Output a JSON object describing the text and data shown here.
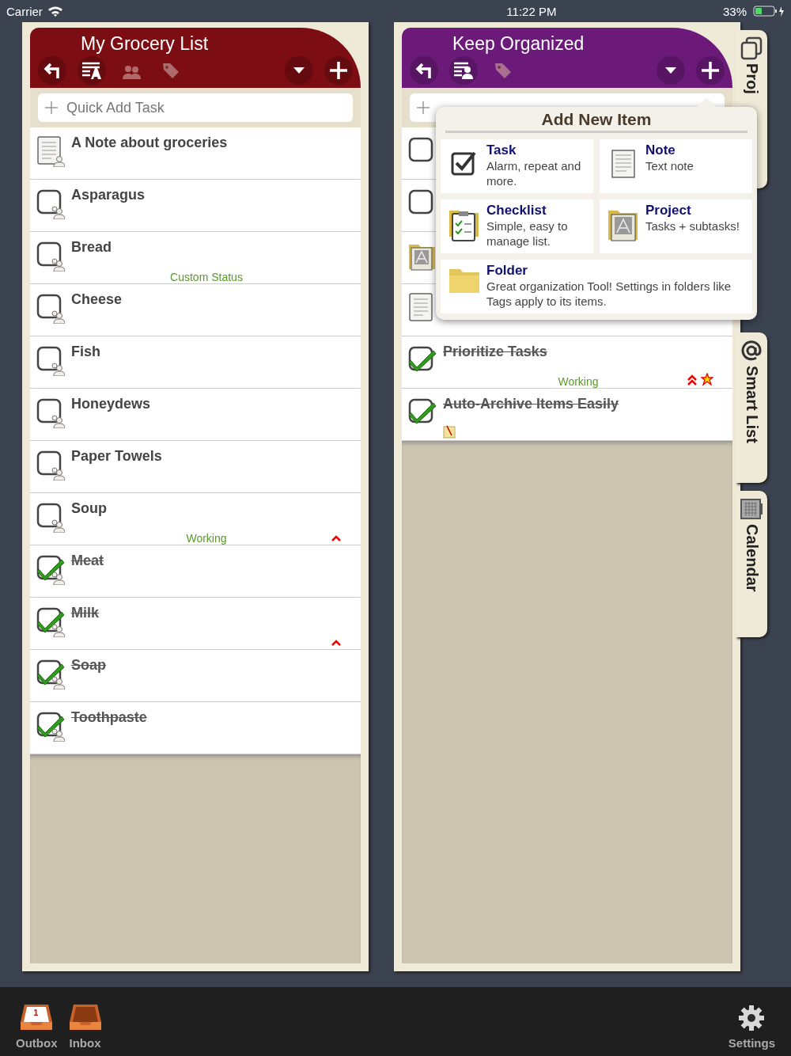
{
  "status_bar": {
    "carrier": "Carrier",
    "time": "11:22 PM",
    "battery": "33%"
  },
  "lists": [
    {
      "title": "My Grocery List",
      "color": "#7c0d12",
      "toolbar": [
        {
          "kind": "back",
          "disabled": false
        },
        {
          "kind": "format",
          "disabled": false
        },
        {
          "kind": "people",
          "disabled": true
        },
        {
          "kind": "tag",
          "disabled": true
        },
        {
          "kind": "dropdown",
          "disabled": false
        },
        {
          "kind": "add",
          "disabled": false
        }
      ],
      "quick_add": {
        "placeholder": "Quick Add Task"
      },
      "items": [
        {
          "kind": "note",
          "title": "A Note about groceries",
          "shared": true
        },
        {
          "kind": "task",
          "title": "Asparagus",
          "done": false,
          "shared": true
        },
        {
          "kind": "task",
          "title": "Bread",
          "done": false,
          "shared": true,
          "status": "Custom Status"
        },
        {
          "kind": "task",
          "title": "Cheese",
          "done": false,
          "shared": true
        },
        {
          "kind": "task",
          "title": "Fish",
          "done": false,
          "shared": true
        },
        {
          "kind": "task",
          "title": "Honeydews",
          "done": false,
          "shared": true
        },
        {
          "kind": "task",
          "title": "Paper Towels",
          "done": false,
          "shared": true
        },
        {
          "kind": "task",
          "title": "Soup",
          "done": false,
          "shared": true,
          "status": "Working",
          "priority": true
        },
        {
          "kind": "task",
          "title": "Meat",
          "done": true,
          "shared": true
        },
        {
          "kind": "task",
          "title": "Milk",
          "done": true,
          "shared": true,
          "priority": true
        },
        {
          "kind": "task",
          "title": "Soap",
          "done": true,
          "shared": true
        },
        {
          "kind": "task",
          "title": "Toothpaste",
          "done": true,
          "shared": true
        }
      ]
    },
    {
      "title": "Keep Organized",
      "color": "#6b1a7a",
      "toolbar": [
        {
          "kind": "back",
          "disabled": false
        },
        {
          "kind": "assign",
          "disabled": false
        },
        {
          "kind": "tag",
          "disabled": true
        },
        {
          "kind": "dropdown",
          "disabled": false
        },
        {
          "kind": "add",
          "disabled": false
        }
      ],
      "items": [
        {
          "kind": "task",
          "done": false,
          "shared": false
        },
        {
          "kind": "task",
          "done": false,
          "shared": false
        },
        {
          "kind": "project",
          "shared": false
        },
        {
          "kind": "note",
          "shared": false
        },
        {
          "kind": "task",
          "title": "Prioritize Tasks",
          "done": true,
          "shared": false,
          "status": "Working",
          "priority": true,
          "starred": true
        },
        {
          "kind": "task",
          "title": "Auto-Archive Items Easily",
          "done": true,
          "shared": false,
          "attachment": true
        }
      ]
    }
  ],
  "popover": {
    "title": "Add New Item",
    "options": [
      {
        "kind": "task",
        "label": "Task",
        "description": "Alarm, repeat and more."
      },
      {
        "kind": "note",
        "label": "Note",
        "description": "Text note"
      },
      {
        "kind": "checklist",
        "label": "Checklist",
        "description": "Simple, easy to manage list."
      },
      {
        "kind": "project",
        "label": "Project",
        "description": "Tasks + subtasks!"
      },
      {
        "kind": "folder",
        "label": "Folder",
        "description": "Great organization Tool! Settings in folders like Tags apply to its items."
      }
    ]
  },
  "side_tabs": [
    {
      "kind": "project",
      "label": "Proj"
    },
    {
      "kind": "smart",
      "label": "Smart List"
    },
    {
      "kind": "calendar",
      "label": "Calendar"
    }
  ],
  "bottom_bar": [
    {
      "kind": "outbox",
      "label": "Outbox",
      "badge": "1"
    },
    {
      "kind": "inbox",
      "label": "Inbox"
    },
    {
      "kind": "settings",
      "label": "Settings"
    }
  ]
}
